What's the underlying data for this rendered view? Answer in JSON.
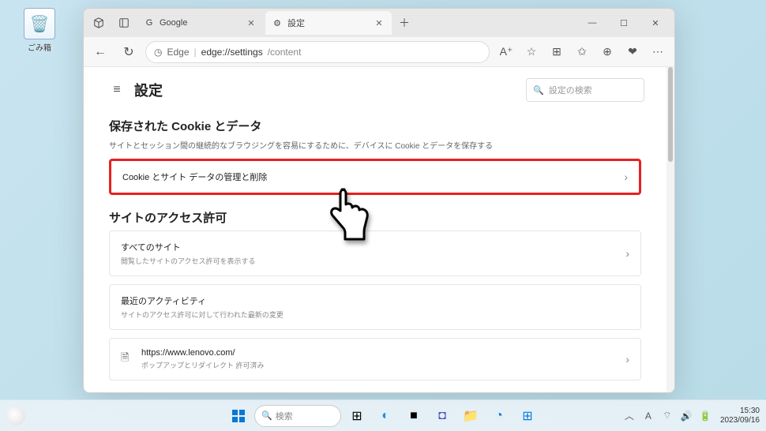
{
  "desktop": {
    "recycle_label": "ごみ箱"
  },
  "tabs": {
    "google": "Google",
    "settings": "設定"
  },
  "addr": {
    "edge_label": "Edge",
    "url_host": "edge://settings",
    "url_path": "/content"
  },
  "page": {
    "title": "設定",
    "search_placeholder": "設定の検索"
  },
  "section1": {
    "heading": "保存された Cookie とデータ",
    "desc": "サイトとセッション間の継続的なブラウジングを容易にするために、デバイスに Cookie とデータを保存する",
    "card_title": "Cookie とサイト データの管理と削除"
  },
  "section2": {
    "heading": "サイトのアクセス許可",
    "all_sites_title": "すべてのサイト",
    "all_sites_sub": "閲覧したサイトのアクセス許可を表示する",
    "recent_title": "最近のアクティビティ",
    "recent_sub": "サイトのアクセス許可に対して行われた最新の変更",
    "site_url": "https://www.lenovo.com/",
    "site_sub": "ポップアップとリダイレクト 許可済み"
  },
  "taskbar": {
    "search_placeholder": "検索",
    "ime": "A",
    "time": "15:30",
    "date": "2023/09/16"
  }
}
